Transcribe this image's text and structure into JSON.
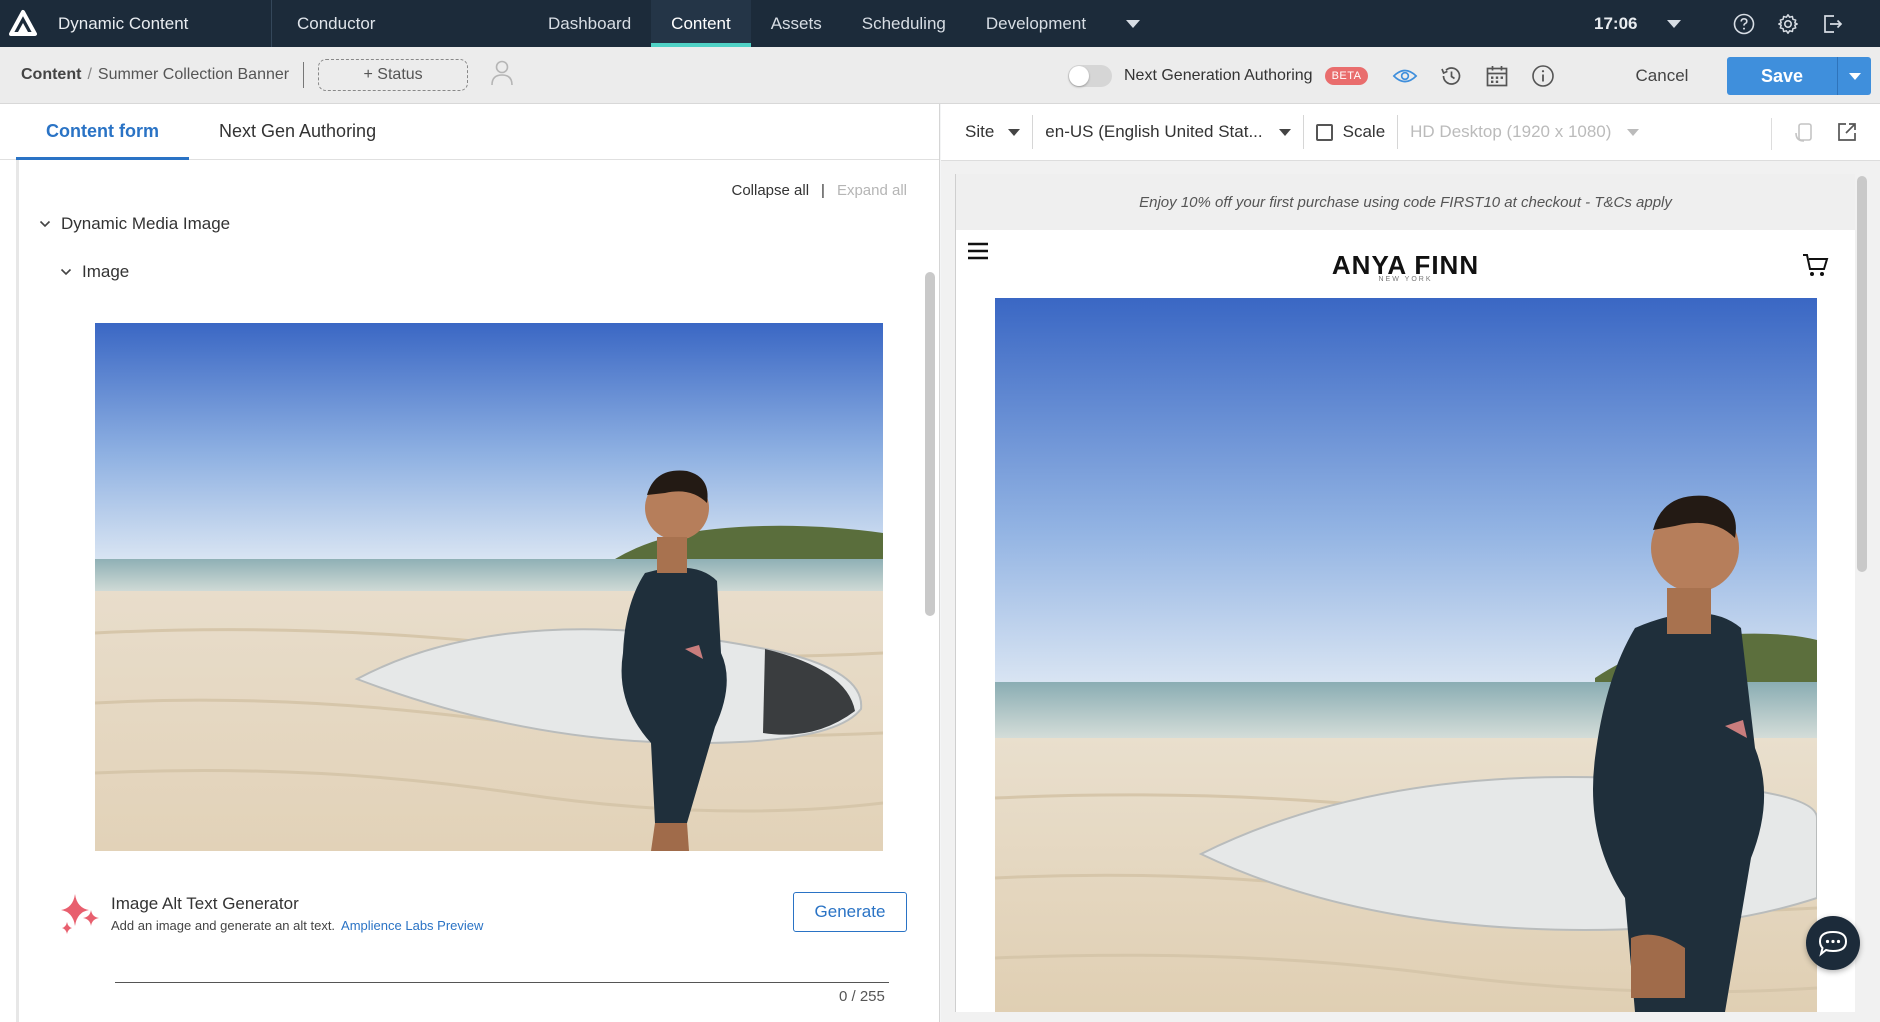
{
  "topnav": {
    "product": "Dynamic Content",
    "app": "Conductor",
    "tabs": [
      {
        "label": "Dashboard"
      },
      {
        "label": "Content"
      },
      {
        "label": "Assets"
      },
      {
        "label": "Scheduling"
      },
      {
        "label": "Development"
      }
    ],
    "active_tab": "Content",
    "clock": "17:06",
    "icons": [
      "help-icon",
      "gear-icon",
      "logout-icon"
    ]
  },
  "toolbar": {
    "breadcrumb_root": "Content",
    "breadcrumb_item": "Summer Collection Banner",
    "status_label": "+ Status",
    "nga_label": "Next Generation Authoring",
    "beta_label": "BETA",
    "cancel_label": "Cancel",
    "save_label": "Save",
    "icons": [
      "eye-icon",
      "history-icon",
      "calendar-icon",
      "info-icon"
    ]
  },
  "left": {
    "tabs": [
      {
        "label": "Content form"
      },
      {
        "label": "Next Gen Authoring"
      }
    ],
    "collapse_all": "Collapse all",
    "separator": "|",
    "expand_all": "Expand all",
    "section": "Dynamic Media Image",
    "subsection": "Image",
    "alt_generator": {
      "title": "Image Alt Text Generator",
      "subtitle": "Add an image and generate an alt text.",
      "link": "Amplience Labs Preview",
      "button": "Generate",
      "counter": "0 / 255"
    }
  },
  "right": {
    "site_label": "Site",
    "locale_label": "en-US (English United Stat...",
    "scale_label": "Scale",
    "device_label": "HD Desktop (1920 x 1080)",
    "promo": "Enjoy 10% off your first purchase using code FIRST10 at checkout - T&Cs apply",
    "brand": "ANYA FINN",
    "brand_sub": "NEW YORK"
  },
  "colors": {
    "nav_bg": "#1c2b3a",
    "accent_teal": "#4fd1c5",
    "primary_blue": "#3f8fdc",
    "link_blue": "#2a73c5",
    "beta_red": "#e96d6d"
  }
}
